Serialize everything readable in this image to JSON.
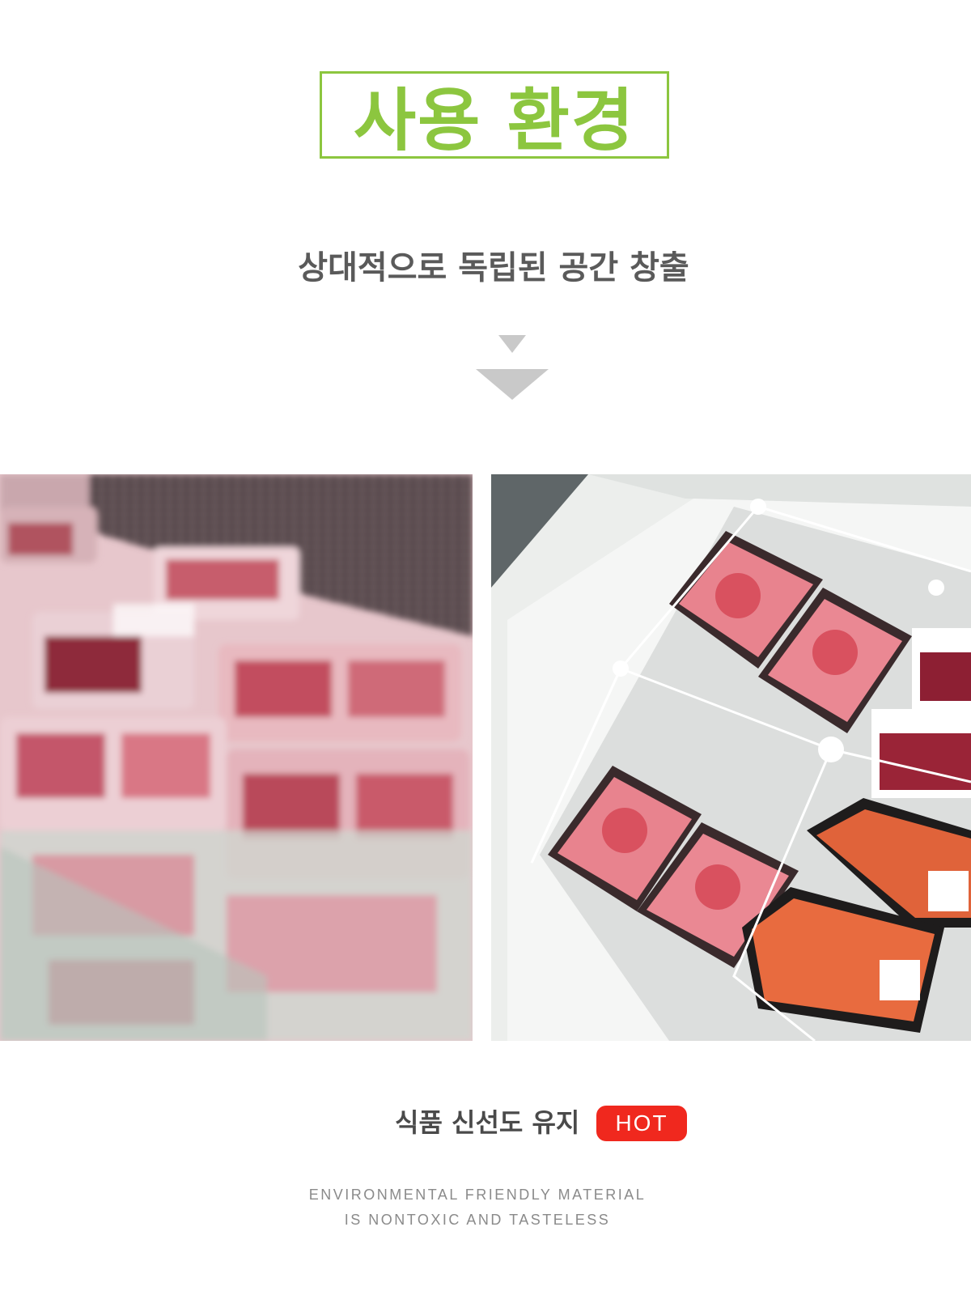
{
  "header": {
    "title": "사용 환경",
    "subtitle": "상대적으로 독립된 공간 창출",
    "title_color": "#8cc63f"
  },
  "icons": {
    "down_arrow": "double-down-triangle-icon"
  },
  "images": {
    "left": "supermarket meat display case",
    "right": "freezer with divided meat and shrimp trays"
  },
  "footer": {
    "caption": "식품 신선도 유지",
    "badge": "HOT",
    "badge_color": "#f0281e",
    "eng_line1": "ENVIRONMENTAL FRIENDLY MATERIAL",
    "eng_line2": "IS NONTOXIC AND TASTELESS"
  }
}
